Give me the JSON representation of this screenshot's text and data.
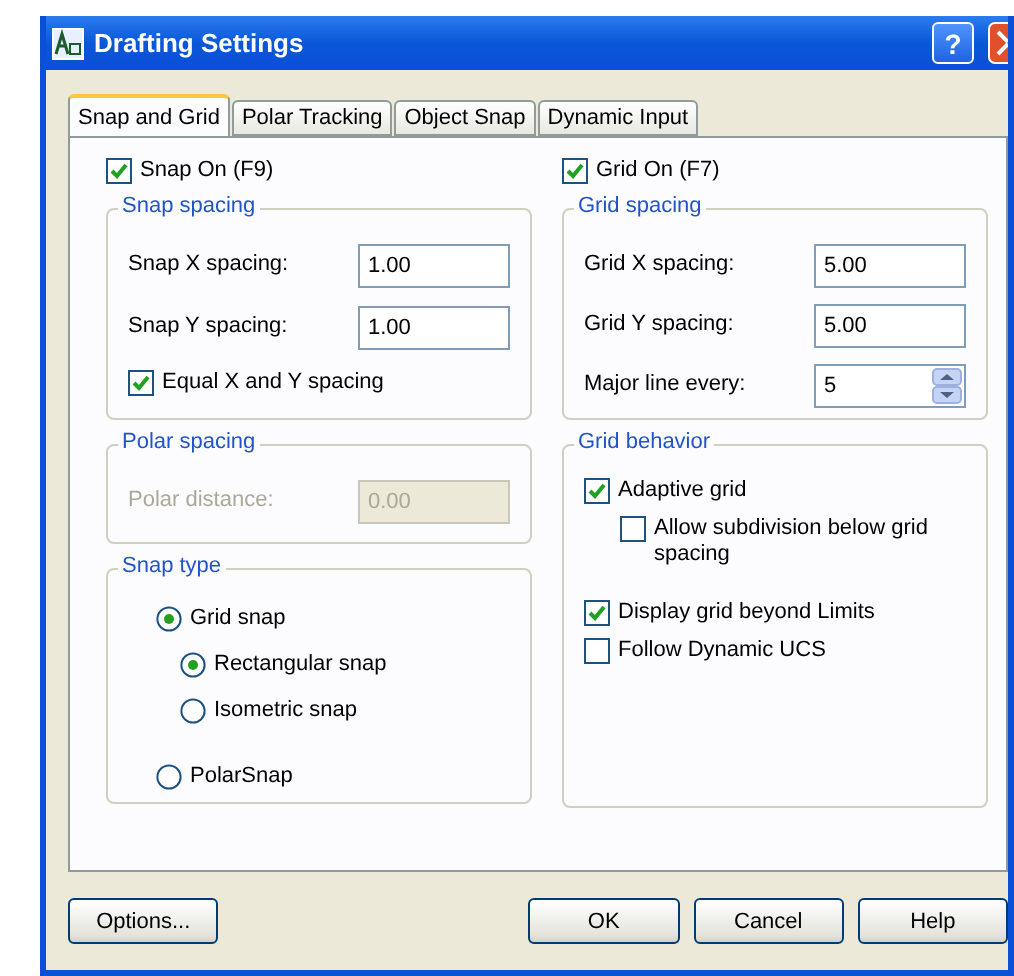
{
  "window": {
    "title": "Drafting Settings",
    "help_button": "?"
  },
  "tabs": [
    {
      "label": "Snap and Grid",
      "selected": true
    },
    {
      "label": "Polar Tracking",
      "selected": false
    },
    {
      "label": "Object Snap",
      "selected": false
    },
    {
      "label": "Dynamic Input",
      "selected": false
    }
  ],
  "snap_on": {
    "label": "Snap On (F9)",
    "checked": true
  },
  "grid_on": {
    "label": "Grid On (F7)",
    "checked": true
  },
  "snap_spacing": {
    "title": "Snap spacing",
    "fields": [
      {
        "label": "Snap X spacing:",
        "value": "1.00",
        "kind": "text"
      },
      {
        "label": "Snap Y spacing:",
        "value": "1.00",
        "kind": "text"
      }
    ],
    "equal": {
      "label": "Equal X and Y spacing",
      "checked": true
    }
  },
  "polar_spacing": {
    "title": "Polar spacing",
    "fields": [
      {
        "label": "Polar distance:",
        "value": "0.00",
        "kind": "text",
        "disabled": true
      }
    ]
  },
  "snap_type": {
    "title": "Snap type",
    "options": [
      {
        "label": "Grid snap",
        "selected": true,
        "children": [
          {
            "label": "Rectangular snap",
            "selected": true
          },
          {
            "label": "Isometric snap",
            "selected": false
          }
        ]
      },
      {
        "label": "PolarSnap",
        "selected": false
      }
    ]
  },
  "grid_spacing": {
    "title": "Grid spacing",
    "fields": [
      {
        "label": "Grid X spacing:",
        "value": "5.00",
        "kind": "text"
      },
      {
        "label": "Grid Y spacing:",
        "value": "5.00",
        "kind": "text"
      },
      {
        "label": "Major line every:",
        "value": "5",
        "kind": "spinner"
      }
    ]
  },
  "grid_behavior": {
    "title": "Grid behavior",
    "options": [
      {
        "label": "Adaptive grid",
        "checked": true,
        "children": [
          {
            "label": "Allow subdivision below grid spacing",
            "checked": false
          }
        ]
      },
      {
        "label": "Display grid beyond Limits",
        "checked": true
      },
      {
        "label": "Follow Dynamic UCS",
        "checked": false
      }
    ]
  },
  "buttons": [
    {
      "label": "Options..."
    },
    {
      "label": "OK"
    },
    {
      "label": "Cancel"
    },
    {
      "label": "Help"
    }
  ]
}
